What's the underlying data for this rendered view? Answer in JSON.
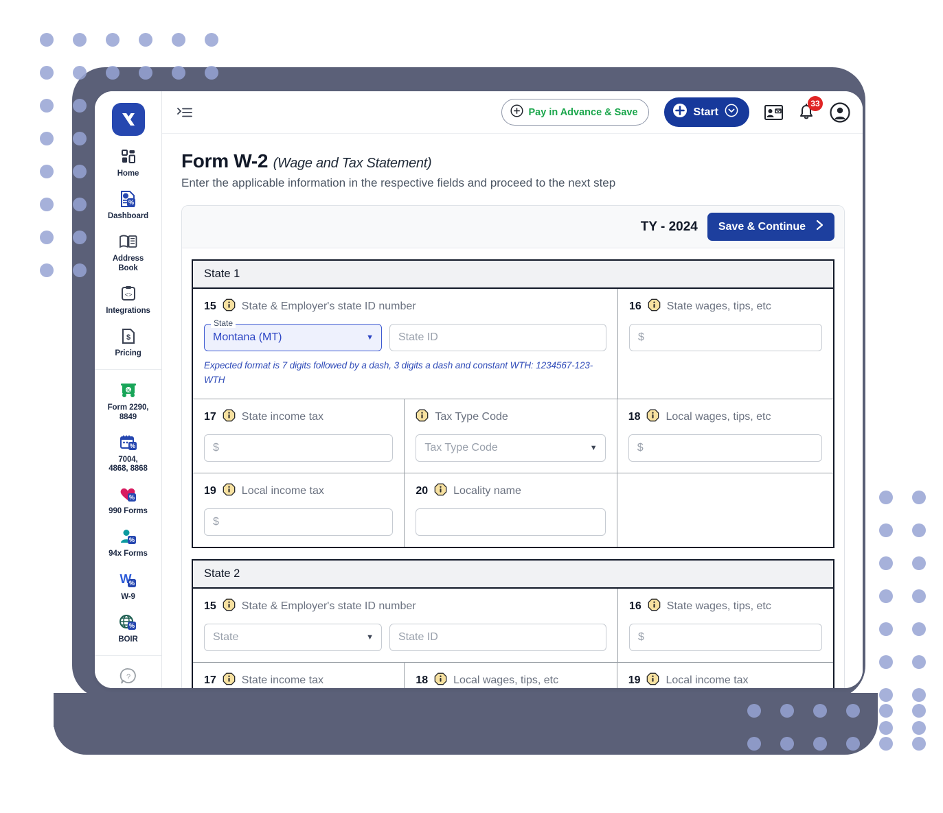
{
  "theme": {
    "accent_blue": "#17399b",
    "frame_gray": "#5b6078",
    "dot_blue": "#97a3d4",
    "green": "#1aa64b",
    "badge_red": "#e02424",
    "info_yellow": "#f7e1a0"
  },
  "sidebar": {
    "logo_name": "taxbandits-logo",
    "groups": [
      {
        "items": [
          {
            "label": "Home",
            "icon": "grid-icon"
          },
          {
            "label": "Dashboard",
            "icon": "document-dashboard-icon"
          },
          {
            "label": "Address\nBook",
            "icon": "address-book-icon"
          },
          {
            "label": "Integrations",
            "icon": "code-clipboard-icon"
          },
          {
            "label": "Pricing",
            "icon": "price-tag-document-icon"
          }
        ]
      },
      {
        "items": [
          {
            "label": "Form 2290,\n8849",
            "icon": "truck-icon"
          },
          {
            "label": "7004,\n4868, 8868",
            "icon": "calendar-icon"
          },
          {
            "label": "990 Forms",
            "icon": "heart-icon"
          },
          {
            "label": "94x Forms",
            "icon": "person-tie-icon"
          },
          {
            "label": "W-9",
            "icon": "w-letter-icon"
          },
          {
            "label": "BOIR",
            "icon": "globe-icon"
          }
        ]
      },
      {
        "items": [
          {
            "label": "",
            "icon": "help-question-icon"
          }
        ]
      }
    ]
  },
  "topbar": {
    "collapse_icon": "collapse-sidebar-icon",
    "pay_in_advance_label": "Pay in Advance & Save",
    "start_label": "Start",
    "contact_card_icon": "contact-card-icon",
    "bell_icon": "notification-bell-icon",
    "notification_count": "33",
    "avatar_icon": "user-avatar-icon"
  },
  "page": {
    "title": "Form W-2",
    "title_sub": "(Wage and Tax Statement)",
    "description": "Enter the applicable information in the respective fields and proceed to the next step"
  },
  "card_header": {
    "tax_year": "TY - 2024",
    "save_continue_label": "Save & Continue"
  },
  "states": [
    {
      "heading": "State 1",
      "f15": {
        "num": "15",
        "label": "State & Employer's state ID number",
        "state_float_label": "State",
        "state_value": "Montana (MT)",
        "state_selected": true,
        "state_id_placeholder": "State ID",
        "hint": "Expected format is 7 digits followed by a dash, 3 digits a dash and constant WTH: 1234567-123-WTH"
      },
      "f16": {
        "num": "16",
        "label": "State wages, tips, etc",
        "placeholder": "$"
      },
      "f17": {
        "num": "17",
        "label": "State income tax",
        "placeholder": "$"
      },
      "tax_type": {
        "label": "Tax Type Code",
        "placeholder": "Tax Type Code"
      },
      "f18": {
        "num": "18",
        "label": "Local wages, tips, etc",
        "placeholder": "$"
      },
      "f19": {
        "num": "19",
        "label": "Local income tax",
        "placeholder": "$"
      },
      "f20": {
        "num": "20",
        "label": "Locality name",
        "placeholder": ""
      }
    },
    {
      "heading": "State 2",
      "f15": {
        "num": "15",
        "label": "State & Employer's state ID number",
        "state_placeholder": "State",
        "state_selected": false,
        "state_id_placeholder": "State ID"
      },
      "f16": {
        "num": "16",
        "label": "State wages, tips, etc",
        "placeholder": "$"
      },
      "f17": {
        "num": "17",
        "label": "State income tax"
      },
      "f18": {
        "num": "18",
        "label": "Local wages, tips, etc"
      },
      "f19": {
        "num": "19",
        "label": "Local income tax"
      }
    }
  ]
}
